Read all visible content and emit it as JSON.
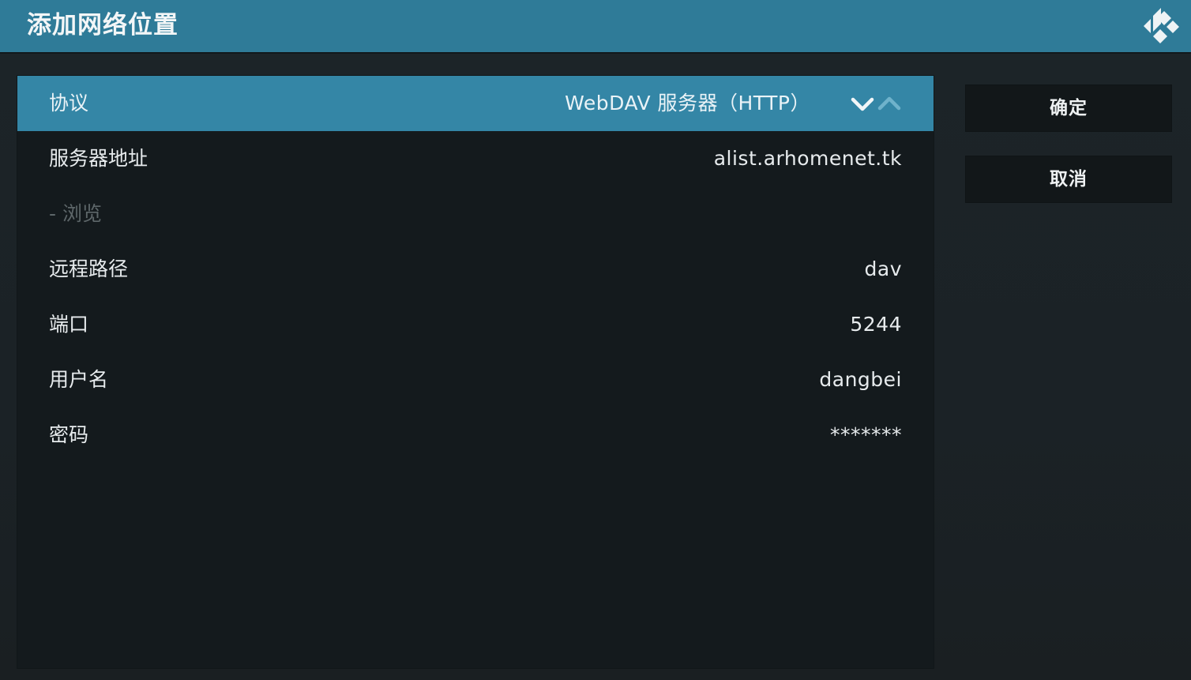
{
  "header": {
    "title": "添加网络位置",
    "logo_icon": "kodi-logo-icon"
  },
  "form": {
    "rows": [
      {
        "label": "协议",
        "value": "WebDAV 服务器（HTTP）",
        "focused": true
      },
      {
        "label": "服务器地址",
        "value": "alist.arhomenet.tk"
      },
      {
        "label": "- 浏览",
        "value": "",
        "disabled": true
      },
      {
        "label": "远程路径",
        "value": "dav"
      },
      {
        "label": "端口",
        "value": "5244"
      },
      {
        "label": "用户名",
        "value": "dangbei"
      },
      {
        "label": "密码",
        "value": "*******"
      }
    ]
  },
  "buttons": {
    "ok_label": "确定",
    "cancel_label": "取消"
  },
  "colors": {
    "header_bg": "#2f7b98",
    "focus_bg": "#3486a6",
    "panel_bg": "#141a1d",
    "button_bg": "#121719"
  }
}
